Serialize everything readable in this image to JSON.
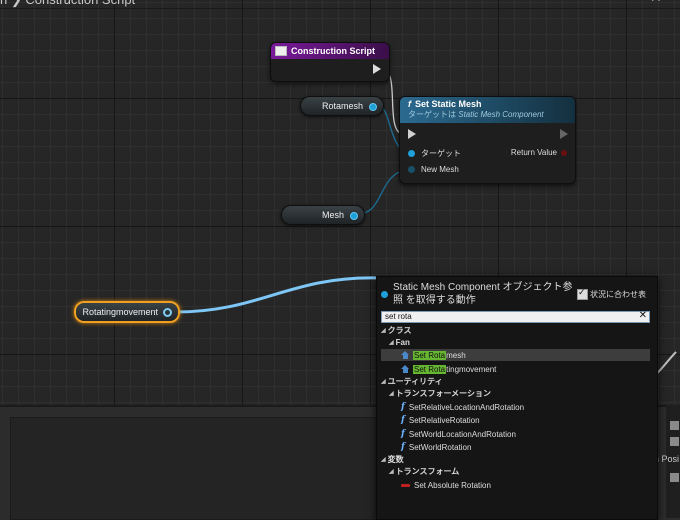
{
  "tab": {
    "title": "n ❯ Construction Script",
    "close": "✕"
  },
  "nodes": {
    "construction_script": {
      "title": "Construction Script"
    },
    "set_static_mesh": {
      "title": "Set Static Mesh",
      "subtitle_prefix": "ターゲットは",
      "subtitle_target": "Static Mesh Component",
      "pins": {
        "target": "ターゲット",
        "return_value": "Return Value",
        "new_mesh": "New Mesh"
      }
    },
    "rotamesh": {
      "label": "Rotamesh"
    },
    "mesh": {
      "label": "Mesh"
    },
    "rotatingmovement": {
      "label": "Rotatingmovement"
    }
  },
  "menu": {
    "title": "Static Mesh Component オブジェクト参照 を取得する動作",
    "context_label": "状況に合わせ表",
    "context_checked": true,
    "search_value": "set rota",
    "categories": {
      "class": "クラス",
      "fan": "Fan",
      "utility": "ユーティリティ",
      "transformation": "トランスフォーメーション",
      "variables": "変数",
      "transform": "トランスフォーム"
    },
    "items": {
      "set_rotamesh": {
        "prefix": "Set Rota",
        "suffix": "mesh"
      },
      "set_rotatingmovement": {
        "prefix": "Set Rota",
        "suffix": "tingmovement"
      },
      "set_relative_location_and_rotation": "SetRelativeLocationAndRotation",
      "set_relative_rotation": "SetRelativeRotation",
      "set_world_location_and_rotation": "SetWorldLocationAndRotation",
      "set_world_rotation": "SetWorldRotation",
      "set_absolute_rotation": "Set Absolute Rotation"
    }
  },
  "bottom": {
    "pos_text": "n Posi"
  },
  "colors": {
    "object_pin": "#1ea0d8",
    "construction_header": "#7a1a9a",
    "function_header": "#2b6a90",
    "search_highlight": "#67b632",
    "selected_outline": "#f0a020"
  }
}
